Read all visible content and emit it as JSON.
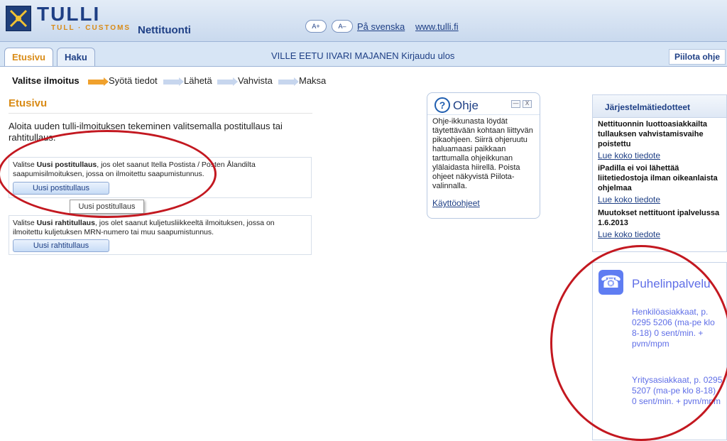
{
  "app": {
    "brand": "TULLI",
    "brand_sub": "TULL · CUSTOMS",
    "title": "Nettituonti"
  },
  "header": {
    "font_increase_label": "A+",
    "font_decrease_label": "A–",
    "swedish_link": "På svenska",
    "site_link": "www.tulli.fi"
  },
  "tabs": [
    {
      "label": "Etusivu",
      "active": true
    },
    {
      "label": "Haku",
      "active": false
    }
  ],
  "user": {
    "name": "VILLE EETU IIVARI MAJANEN",
    "logout_label": "Kirjaudu ulos"
  },
  "hide_help_label": "Piilota ohje",
  "steps": [
    {
      "label": "Valitse ilmoitus",
      "active": true
    },
    {
      "label": "Syötä tiedot",
      "active": false
    },
    {
      "label": "Lähetä",
      "active": false
    },
    {
      "label": "Vahvista",
      "active": false
    },
    {
      "label": "Maksa",
      "active": false
    }
  ],
  "page": {
    "title": "Etusivu",
    "intro": "Aloita uuden tulli-ilmoituksen tekeminen valitsemalla postitullaus tai rahtitullaus."
  },
  "options": [
    {
      "prefix": "Valitse ",
      "strong": "Uusi postitullaus",
      "text": ", jos olet saanut Itella Postista / Posten Ålandilta saapumisilmoituksen, jossa on ilmoitettu saapumistunnus.",
      "button_label": "Uusi postitullaus"
    },
    {
      "prefix": "Valitse ",
      "strong": "Uusi rahtitullaus",
      "text": ", jos olet saanut kuljetusliikkeeltä ilmoituksen, jossa on ilmoitettu kuljetuksen MRN-numero tai muu saapumistunnus.",
      "button_label": "Uusi rahtitullaus"
    }
  ],
  "tooltip": "Uusi postitullaus",
  "help": {
    "title": "Ohje",
    "text": "Ohje-ikkunasta löydät täytettävään kohtaan liittyvän pikaohjeen. Siirrä ohjeruutu haluamaasi paikkaan tarttumalla ohjeikkunan ylälaidasta hiirellä. Poista ohjeet näkyvistä Piilota-valinnalla.",
    "link": "Käyttöohjeet",
    "minimize_glyph": "—",
    "close_glyph": "X"
  },
  "system_notices": {
    "title": "Järjestelmätiedotteet",
    "items": [
      {
        "heading": "Nettituonnin luottoasiakkailta tullauksen vahvistamisvaihe poistettu",
        "link": "Lue koko tiedote"
      },
      {
        "heading": "iPadilla ei voi lähettää liitetiedostoja ilman oikeanlaista ohjelmaa",
        "link": "Lue koko tiedote"
      },
      {
        "heading": "Muutokset nettituont ipalvelussa 1.6.2013",
        "link": "Lue koko tiedote"
      }
    ]
  },
  "phone_service": {
    "title": "Puhelinpalvelu",
    "personal": "Henkilöasiakkaat, p. 0295 5206 (ma-pe klo 8-18) 0 sent/min. + pvm/mpm",
    "business": "Yritysasiakkaat, p. 0295 5207 (ma-pe klo 8-18) 0 sent/min. + pvm/mpm"
  },
  "colors": {
    "brand_blue": "#1e3f85",
    "accent_orange": "#d98b16",
    "highlight_red": "#c31820",
    "phone_violet": "#5f6ee7"
  }
}
